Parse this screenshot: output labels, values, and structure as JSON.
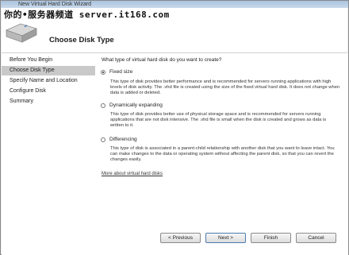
{
  "window": {
    "title": "New Virtual Hard Disk Wizard"
  },
  "watermark": "你的•服务器频道 server.it168.com",
  "header": {
    "title": "Choose Disk Type",
    "icon": "hard-disk-icon"
  },
  "sidebar": {
    "items": [
      {
        "label": "Before You Begin"
      },
      {
        "label": "Choose Disk Type"
      },
      {
        "label": "Specify Name and Location"
      },
      {
        "label": "Configure Disk"
      },
      {
        "label": "Summary"
      }
    ]
  },
  "content": {
    "question": "What type of virtual hard disk do you want to create?",
    "options": [
      {
        "label": "Fixed size",
        "selected": true,
        "description": "This type of disk provides better performance and is recommended for servers running applications with high levels of disk activity. The .vhd file is created using the size of the fixed virtual hard disk. It does not change when data is added or deleted."
      },
      {
        "label": "Dynamically expanding",
        "selected": false,
        "description": "This type of disk provides better use of physical storage space and is recommended for servers running applications that are not disk intensive. The .vhd file is small when the disk is created and grows as data is written to it."
      },
      {
        "label": "Differencing",
        "selected": false,
        "description": "This type of disk is associated in a parent-child relationship with another disk that you want to leave intact. You can make changes to the data or operating system without affecting the parent disk, so that you can revert the changes easily."
      }
    ],
    "link": "More about virtual hard disks"
  },
  "buttons": {
    "previous": "< Previous",
    "next": "Next >",
    "finish": "Finish",
    "cancel": "Cancel"
  }
}
